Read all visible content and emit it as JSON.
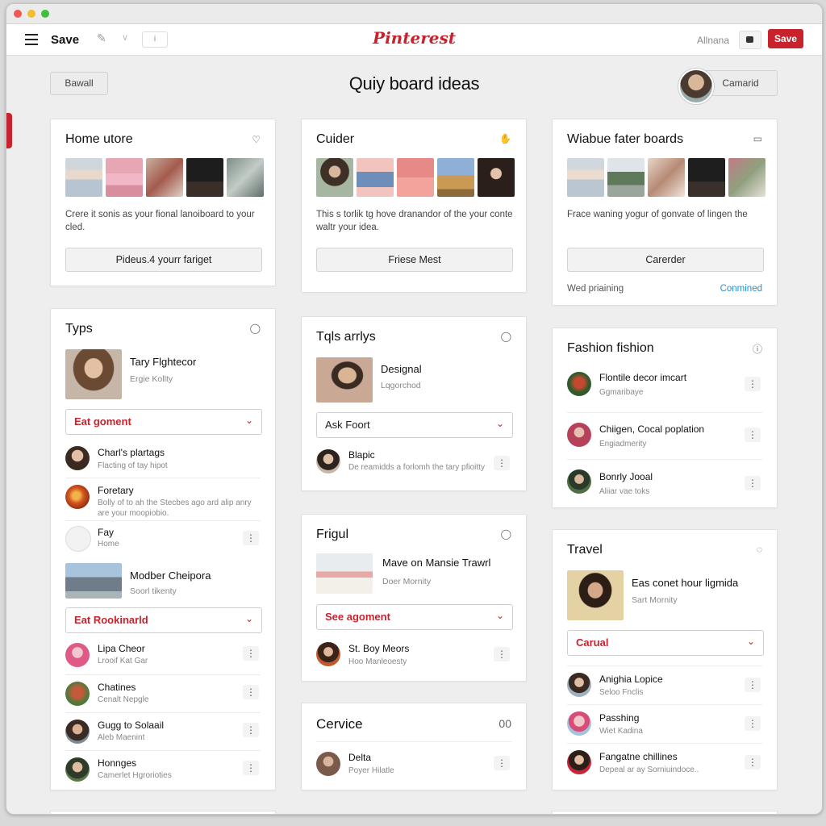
{
  "toolbar": {
    "save_label": "Save",
    "box_label": "i",
    "logo": "Pinterest",
    "user": "Allnana",
    "save_button": "Save"
  },
  "header": {
    "left_button": "Bawall",
    "title": "Quiy board ideas",
    "right_button": "Camarid"
  },
  "colors": {
    "brand": "#c8232c",
    "link": "#2a8fd0"
  },
  "card1": {
    "title": "Home utore",
    "icon": "heart-outline-icon",
    "desc": "Crere it sonis as your fional lanoiboard to your cled.",
    "button": "Pideus.4 yourr fariget"
  },
  "card2": {
    "title": "Cuider",
    "icon": "hand-icon",
    "desc": "This s torlik tg hove dranandor of the your conte waltr your idea.",
    "button": "Friese Mest"
  },
  "card3": {
    "title": "Wiabue fater boards",
    "icon": "comment-icon",
    "desc": "Frace waning yogur of gonvate of lingen the",
    "button": "Carerder",
    "foot_left": "Wed priaining",
    "foot_right": "Conmined"
  },
  "typs": {
    "title": "Typs",
    "feature_title": "Tary Flghtecor",
    "feature_sub": "Ergie Kollty",
    "select1": "Eat goment",
    "rows1": [
      {
        "title": "Charl's plartags",
        "sub": "Flacting of tay hipot"
      },
      {
        "title": "Foretary",
        "sub": "Bolly of to ah the Stecbes ago ard alip anry are your moopiobio."
      },
      {
        "title": "Fay",
        "sub": "Home"
      }
    ],
    "feature2_title": "Modber Cheipora",
    "feature2_sub": "Soorl tikenty",
    "select2": "Eat Rookinarld",
    "rows2": [
      {
        "title": "Lipa Cheor",
        "sub": "Lrooif Kat Gar"
      },
      {
        "title": "Chatines",
        "sub": "Cenalt Nepgle"
      },
      {
        "title": "Gugg to Solaail",
        "sub": "Aleb Maenint"
      },
      {
        "title": "Honnges",
        "sub": "Camerlet Hgrorioties"
      }
    ]
  },
  "tols": {
    "title": "Tqls arrlys",
    "feature_title": "Designal",
    "feature_sub": "Lqgorchod",
    "select": "Ask Foort",
    "row": {
      "title": "Blapic",
      "sub": "De reamidds a forlomh the tary pfioitty"
    }
  },
  "frigul": {
    "title": "Frigul",
    "feature_title": "Mave on Mansie Trawrl",
    "feature_sub": "Doer Mornity",
    "select": "See agoment",
    "row": {
      "title": "St. Boy Meors",
      "sub": "Hoo Manleoesty"
    }
  },
  "cervice": {
    "title": "Cervice",
    "count": "00",
    "row": {
      "title": "Delta",
      "sub": "Poyer Hilatle"
    }
  },
  "fashion": {
    "title": "Fashion fishion",
    "rows": [
      {
        "title": "Flontile decor imcart",
        "sub": "Ggmaribaye"
      },
      {
        "title": "Chiigen, Cocal poplation",
        "sub": "Engiadmerity"
      },
      {
        "title": "Bonrly Jooal",
        "sub": "Aliiar vae toks"
      }
    ]
  },
  "travel": {
    "title": "Travel",
    "feature_title": "Eas conet hour ligmida",
    "feature_sub": "Sart Mornity",
    "select": "Carual",
    "rows": [
      {
        "title": "Anighia Lopice",
        "sub": "Seloo Fnclis"
      },
      {
        "title": "Passhing",
        "sub": "Wiet Kadina"
      },
      {
        "title": "Fangatne chillines",
        "sub": "Depeal ar ay Sorniuindoce.."
      }
    ]
  },
  "more_glyph": "⋮"
}
